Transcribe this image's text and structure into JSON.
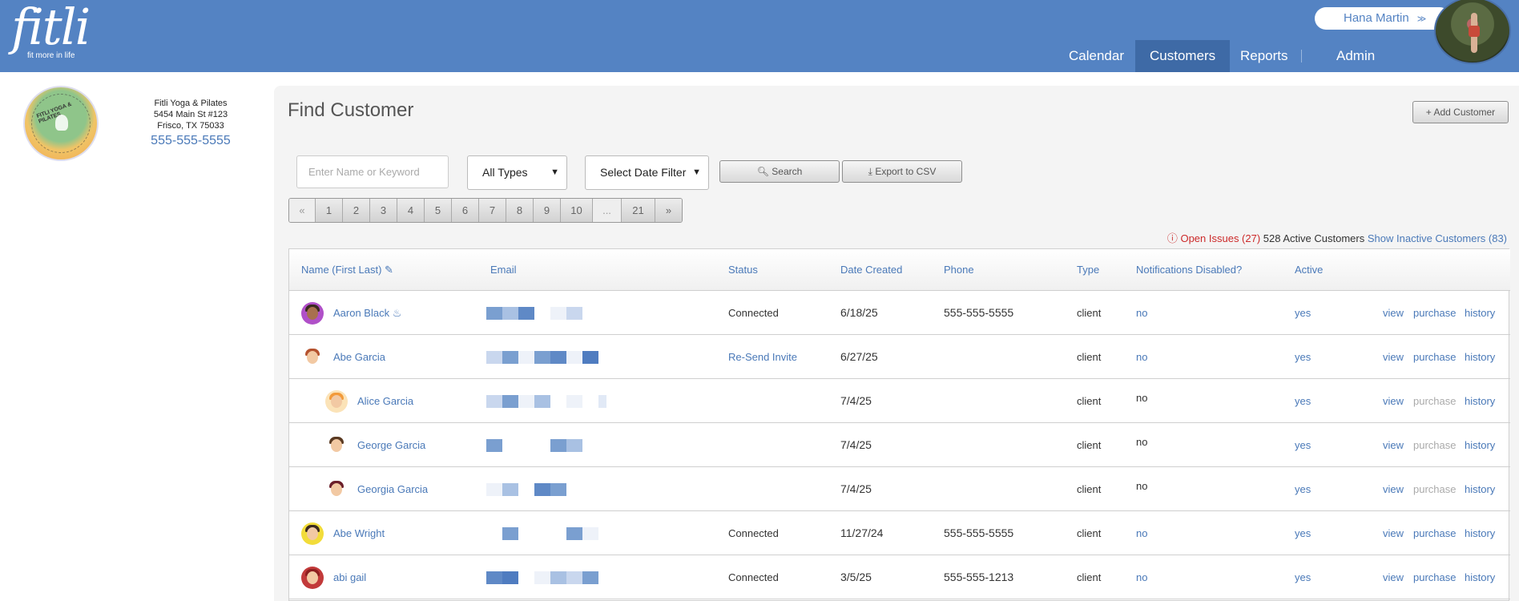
{
  "brand": {
    "logo": "fitli",
    "tagline": "fit more in life"
  },
  "user": {
    "name": "Hana Martin",
    "menu_icon": "double-chevron-down-icon"
  },
  "nav": [
    {
      "label": "Calendar",
      "active": false
    },
    {
      "label": "Customers",
      "active": true
    },
    {
      "label": "Reports",
      "active": false
    },
    {
      "label": "Admin",
      "active": false
    }
  ],
  "business": {
    "logo_text": "FITLI YOGA & PILATES",
    "name": "Fitli Yoga & Pilates",
    "address1": "5454 Main St #123",
    "address2": "Frisco, TX 75033",
    "phone": "555-555-5555"
  },
  "page": {
    "title": "Find Customer",
    "add_button": "+ Add Customer"
  },
  "filters": {
    "search_placeholder": "Enter Name or Keyword",
    "type_select": "All Types",
    "date_select": "Select Date Filter",
    "search_button": "Search",
    "export_button": "Export to CSV"
  },
  "pagination": [
    "«",
    "1",
    "2",
    "3",
    "4",
    "5",
    "6",
    "7",
    "8",
    "9",
    "10",
    "...",
    "21",
    "»"
  ],
  "summary": {
    "issues": "Open Issues (27)",
    "active": "528 Active Customers",
    "inactive_link": "Show Inactive Customers (83)"
  },
  "columns": [
    "Name (First Last)",
    "Email",
    "Status",
    "Date Created",
    "Phone",
    "Type",
    "Notifications Disabled?",
    "Active"
  ],
  "actions": {
    "view": "view",
    "purchase": "purchase",
    "history": "history"
  },
  "rows": [
    {
      "name": "Aaron Black",
      "status": "Connected",
      "date": "6/18/25",
      "phone": "555-555-5555",
      "type": "client",
      "notif": "no",
      "active": "yes",
      "purchase_enabled": true
    },
    {
      "name": "Abe Garcia",
      "status": "Re-Send Invite",
      "date": "6/27/25",
      "phone": "",
      "type": "client",
      "notif": "no",
      "active": "yes",
      "purchase_enabled": true
    },
    {
      "name": "Alice Garcia",
      "status": "",
      "date": "7/4/25",
      "phone": "",
      "type": "client",
      "notif": "no",
      "active": "yes",
      "purchase_enabled": false
    },
    {
      "name": "George Garcia",
      "status": "",
      "date": "7/4/25",
      "phone": "",
      "type": "client",
      "notif": "no",
      "active": "yes",
      "purchase_enabled": false
    },
    {
      "name": "Georgia Garcia",
      "status": "",
      "date": "7/4/25",
      "phone": "",
      "type": "client",
      "notif": "no",
      "active": "yes",
      "purchase_enabled": false
    },
    {
      "name": "Abe Wright",
      "status": "Connected",
      "date": "11/27/24",
      "phone": "555-555-5555",
      "type": "client",
      "notif": "no",
      "active": "yes",
      "purchase_enabled": true
    },
    {
      "name": "abi gail",
      "status": "Connected",
      "date": "3/5/25",
      "phone": "555-555-1213",
      "type": "client",
      "notif": "no",
      "active": "yes",
      "purchase_enabled": true
    }
  ]
}
